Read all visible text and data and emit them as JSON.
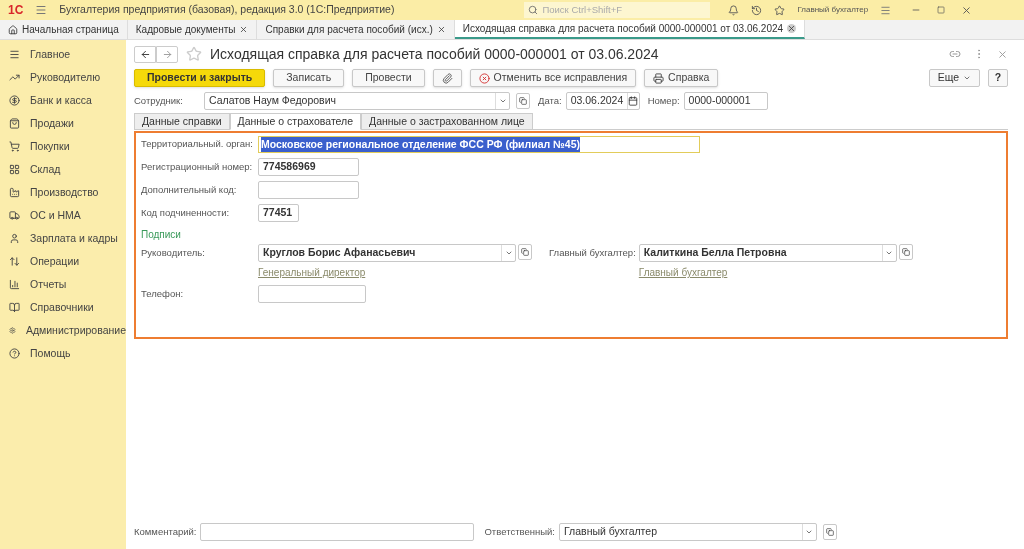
{
  "header": {
    "logo": "1С",
    "app_title": "Бухгалтерия предприятия (базовая), редакция 3.0  (1С:Предприятие)",
    "search_placeholder": "Поиск Ctrl+Shift+F",
    "user": "Главный бухгалтер"
  },
  "open_tabs": [
    {
      "label": "Начальная страница",
      "selected": false,
      "closable": false
    },
    {
      "label": "Кадровые документы",
      "selected": false,
      "closable": true
    },
    {
      "label": "Справки для расчета пособий (исх.)",
      "selected": false,
      "closable": true
    },
    {
      "label": "Исходящая справка для расчета пособий 0000-000001 от 03.06.2024",
      "selected": true,
      "closable": true
    }
  ],
  "sidebar": {
    "items": [
      {
        "label": "Главное"
      },
      {
        "label": "Руководителю"
      },
      {
        "label": "Банк и касса"
      },
      {
        "label": "Продажи"
      },
      {
        "label": "Покупки"
      },
      {
        "label": "Склад"
      },
      {
        "label": "Производство"
      },
      {
        "label": "ОС и НМА"
      },
      {
        "label": "Зарплата и кадры"
      },
      {
        "label": "Операции"
      },
      {
        "label": "Отчеты"
      },
      {
        "label": "Справочники"
      },
      {
        "label": "Администрирование"
      },
      {
        "label": "Помощь"
      }
    ]
  },
  "document": {
    "title": "Исходящая справка для расчета пособий 0000-000001 от 03.06.2024",
    "toolbar": [
      {
        "kind": "primary",
        "label": "Провести и закрыть"
      },
      {
        "kind": "plain",
        "label": "Записать"
      },
      {
        "kind": "plain",
        "label": "Провести"
      },
      {
        "kind": "attach"
      },
      {
        "kind": "cancel",
        "label": "Отменить все исправления"
      },
      {
        "kind": "print",
        "label": "Справка"
      }
    ],
    "more": "Еще",
    "help": "?",
    "employee": {
      "label": "Сотрудник:",
      "value": "Салатов Наум Федорович"
    },
    "date": {
      "label": "Дата:",
      "value": "03.06.2024"
    },
    "number": {
      "label": "Номер:",
      "value": "0000-000001"
    },
    "tabs": [
      {
        "label": "Данные справки",
        "selected": false
      },
      {
        "label": "Данные о страхователе",
        "selected": true
      },
      {
        "label": "Данные о застрахованном лице",
        "selected": false
      }
    ],
    "insurer": {
      "territorial": {
        "label": "Территориальный. орган:",
        "value": "Московское региональное отделение  ФСС РФ (филиал №45)",
        "selected": true
      },
      "reg_number": {
        "label": "Регистрационный номер:",
        "value": "774586969"
      },
      "extra_code": {
        "label": "Дополнительный код:"
      },
      "subordination": {
        "label": "Код подчиненности:",
        "value": "77451"
      },
      "signatures_heading": "Подписи",
      "head": {
        "label": "Руководитель:",
        "value": "Круглов Борис Афанасьевич",
        "position": "Генеральный директор"
      },
      "accountant": {
        "label": "Главный бухгалтер:",
        "value": "Калиткина Белла Петровна",
        "position": "Главный бухгалтер"
      },
      "phone": {
        "label": "Телефон:"
      }
    },
    "comment": {
      "label": "Комментарий:"
    },
    "responsible": {
      "label": "Ответственный:",
      "value": "Главный бухгалтер"
    }
  }
}
